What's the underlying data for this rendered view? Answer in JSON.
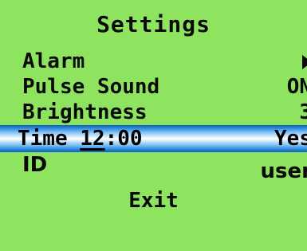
{
  "screen": {
    "title": "Settings",
    "background_color": "#8ee35f",
    "highlight_color": "#2f8be0"
  },
  "menu": {
    "items": [
      {
        "label": "Alarm",
        "value_icon": "play-arrow-icon"
      },
      {
        "label": "Pulse Sound",
        "value": "ON"
      },
      {
        "label": "Brightness",
        "value": "3"
      },
      {
        "label_prefix": "Time ",
        "label_cursor": "12",
        "label_suffix": ":00",
        "value": "Yes"
      },
      {
        "label": "ID",
        "value": "user"
      }
    ],
    "exit_label": "Exit"
  }
}
